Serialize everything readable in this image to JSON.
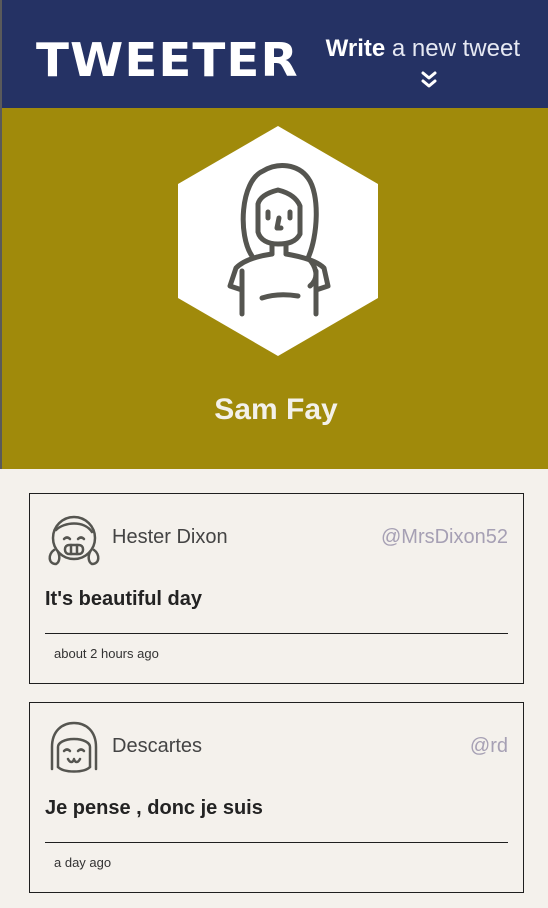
{
  "header": {
    "brand": "TWEETER",
    "compose_bold": "Write",
    "compose_rest": " a new tweet",
    "compose_icon": "chevron-double-down-icon",
    "background": "#253264"
  },
  "profile": {
    "name": "Sam Fay",
    "avatar_icon": "woman-avatar-icon",
    "background": "#a08a0b"
  },
  "tweets": [
    {
      "author": "Hester Dixon",
      "handle": "@MrsDixon52",
      "text": "It's beautiful day",
      "time": "about 2 hours ago",
      "avatar_icon": "girl-pigtails-avatar-icon"
    },
    {
      "author": "Descartes",
      "handle": "@rd",
      "text": "Je pense , donc je suis",
      "time": "a day ago",
      "avatar_icon": "smiling-girl-avatar-icon"
    }
  ]
}
